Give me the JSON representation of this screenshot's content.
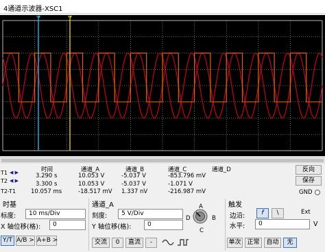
{
  "window": {
    "title": "4通道示波器-XSC1"
  },
  "measure": {
    "headers": [
      "时间",
      "通道_A",
      "通道_B",
      "通道_C",
      "通道_D"
    ],
    "rows": [
      {
        "label": "T1",
        "time": "3.290 s",
        "a": "10.053 V",
        "b": "-5.037 V",
        "c": "-853.796 mV",
        "d": ""
      },
      {
        "label": "T2",
        "time": "3.300 s",
        "a": "10.053 V",
        "b": "-5.037 V",
        "c": "-1.071 V",
        "d": ""
      },
      {
        "label": "T2-T1",
        "time": "10.057 ms",
        "a": "-18.517 mV",
        "b": "1.337 nV",
        "c": "-216.987 mV",
        "d": ""
      }
    ],
    "buttons": {
      "reverse": "反向",
      "save": "保存",
      "gnd": "GND"
    }
  },
  "timebase": {
    "title": "时基",
    "scale_label": "标度:",
    "scale_value": "10 ms/Div",
    "xpos_label": "X 轴位移(格):",
    "xpos_value": "0",
    "modes": [
      "Y/T",
      "A/B >",
      "A+B >"
    ],
    "active_mode": "Y/T"
  },
  "channel": {
    "title": "通道_A",
    "scale_label": "刻度:",
    "scale_value": "5 V/Div",
    "ypos_label": "Y 轴位移(格):",
    "ypos_value": "0",
    "coupling": [
      "交流",
      "0",
      "直流"
    ],
    "knob_labels": [
      "A",
      "B",
      "C",
      "D"
    ]
  },
  "trigger": {
    "title": "触发",
    "edge_label": "边沿:",
    "edge_rise": "f",
    "edge_fall": "\\",
    "ext_label": "Ext",
    "level_label": "水平:",
    "level_value": "0",
    "level_unit": "V",
    "modes": [
      "单次",
      "正常",
      "自动",
      "无"
    ],
    "active_mode": "无"
  },
  "colors": {
    "screen_bg": "#000000",
    "grid": "#b8b8b8",
    "trace_sine": "#c8001e",
    "trace_square": "#e06400",
    "cursor_t1": "#19b9e6",
    "cursor_t2": "#e6c800"
  },
  "chart_data": {
    "type": "line",
    "x_divisions": 10,
    "y_divisions": 8,
    "series": [
      {
        "channel": "A",
        "shape": "sine",
        "amplitude_v": 10,
        "period_ms": 10,
        "volts_per_div": 5
      },
      {
        "channel": "B",
        "shape": "sine",
        "amplitude_v": 10,
        "period_ms": 10,
        "phase_deg": 120,
        "volts_per_div": 5
      },
      {
        "channel": "C",
        "shape": "square",
        "high_v": 10,
        "low_v": -5,
        "period_ms": 10,
        "volts_per_div": 5
      }
    ],
    "cursors": [
      {
        "name": "T1",
        "time_s": 3.29
      },
      {
        "name": "T2",
        "time_s": 3.3
      }
    ]
  }
}
